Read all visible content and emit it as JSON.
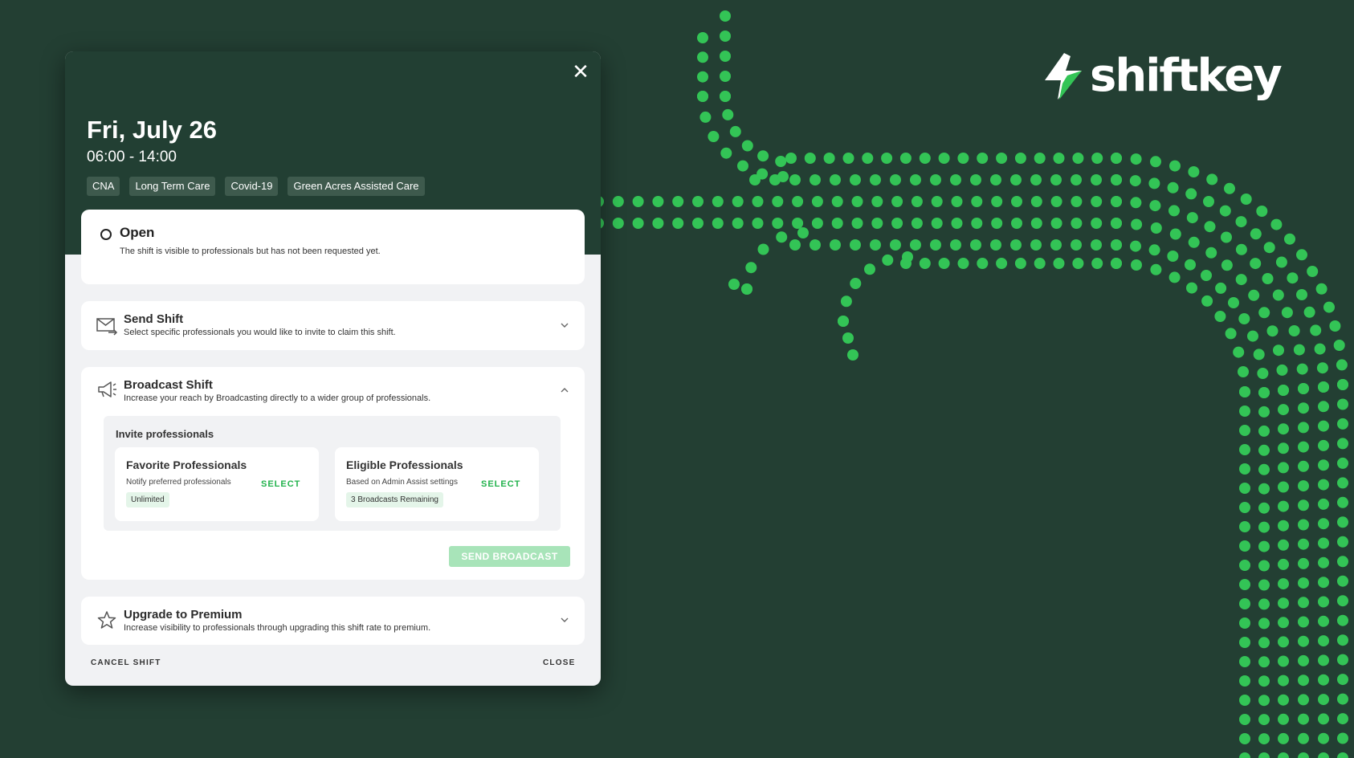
{
  "brand": {
    "name": "shiftkey",
    "accent": "#33c456",
    "bg": "#233f33"
  },
  "modal": {
    "close_icon": "close-icon",
    "date": "Fri, July 26",
    "time": "06:00 - 14:00",
    "tags": [
      "CNA",
      "Long Term Care",
      "Covid-19",
      "Green Acres Assisted Care"
    ]
  },
  "status": {
    "title": "Open",
    "description": "The shift is visible to professionals but has not been requested yet."
  },
  "send_shift": {
    "title": "Send Shift",
    "description": "Select specific professionals you would like to invite to claim this shift.",
    "icon": "envelope-arrow-icon",
    "expanded": false
  },
  "broadcast_shift": {
    "title": "Broadcast Shift",
    "description": "Increase your reach by Broadcasting directly to a wider group of professionals.",
    "icon": "megaphone-icon",
    "expanded": true,
    "invite_label": "Invite professionals",
    "favorite": {
      "title": "Favorite Professionals",
      "description": "Notify preferred professionals",
      "select_label": "SELECT",
      "badge": "Unlimited"
    },
    "eligible": {
      "title": "Eligible Professionals",
      "description": "Based on Admin Assist settings",
      "select_label": "SELECT",
      "badge": "3 Broadcasts Remaining"
    },
    "send_label": "SEND BROADCAST"
  },
  "premium": {
    "title": "Upgrade to Premium",
    "description": "Increase visibility to professionals through upgrading this shift rate to premium.",
    "icon": "star-icon",
    "expanded": false
  },
  "footer": {
    "cancel_label": "CANCEL SHIFT",
    "close_label": "CLOSE"
  }
}
